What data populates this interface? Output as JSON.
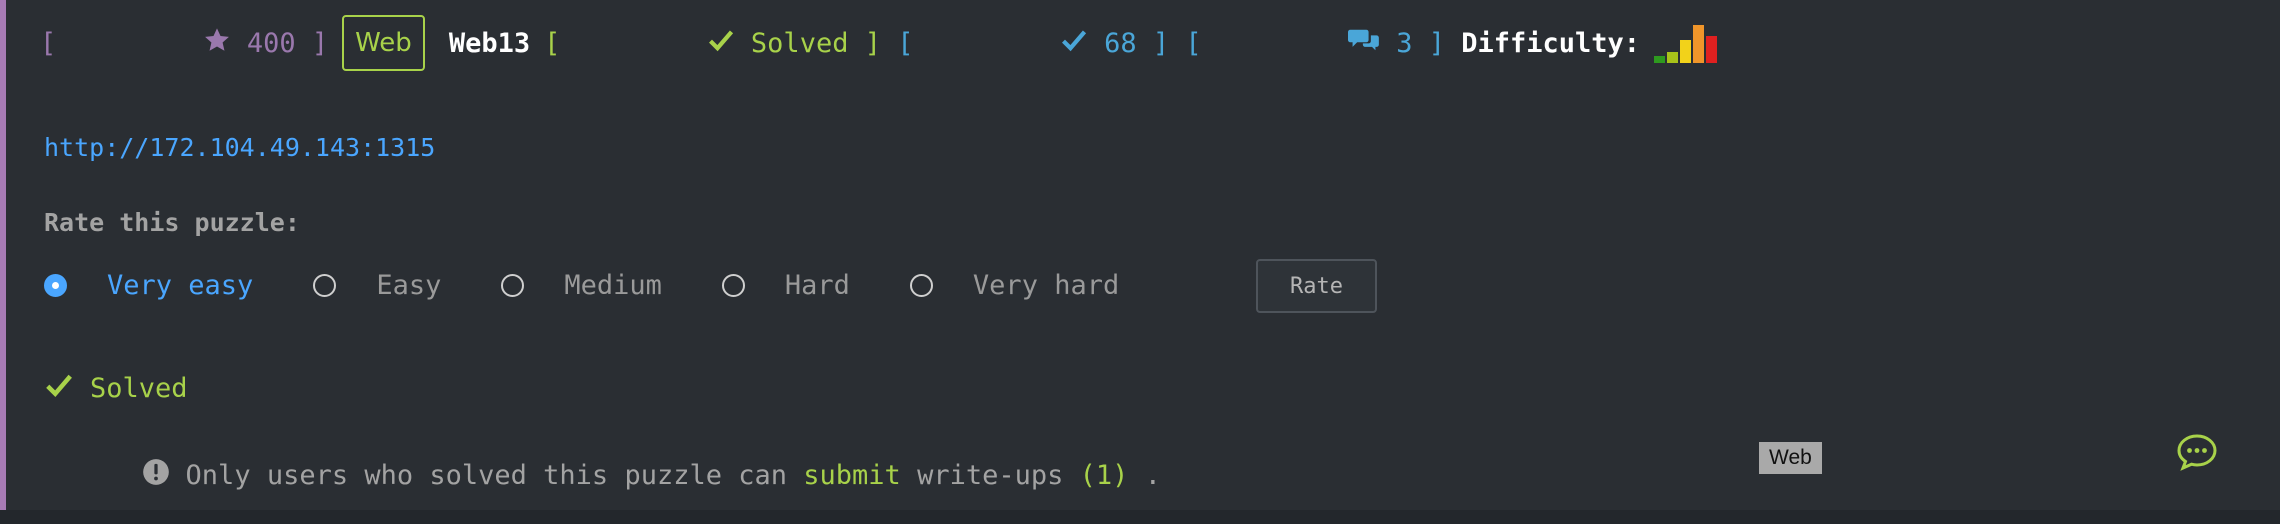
{
  "colors": {
    "accent_green": "#a8d24a",
    "accent_blue": "#4aa6ff",
    "points_purple": "#9a78ad",
    "solves_blue": "#4aa6d8",
    "background": "#2a2e33"
  },
  "header": {
    "points": "400",
    "points_icon": "star-icon",
    "category": "Web",
    "name": "Web13",
    "status": "Solved",
    "status_icon": "check-icon",
    "solves": "68",
    "solves_icon": "check-icon",
    "comments": "3",
    "comments_icon": "comments-icon",
    "difficulty_label": "Difficulty:",
    "difficulty_bars": [
      {
        "level": 0.18,
        "color": "#2e9a1f"
      },
      {
        "level": 0.3,
        "color": "#a8c21a"
      },
      {
        "level": 0.6,
        "color": "#f2d21a"
      },
      {
        "level": 1.0,
        "color": "#f0952a"
      },
      {
        "level": 0.72,
        "color": "#e02020"
      }
    ]
  },
  "url": "http://172.104.49.143:1315",
  "rating": {
    "title": "Rate this puzzle:",
    "options": [
      "Very easy",
      "Easy",
      "Medium",
      "Hard",
      "Very hard"
    ],
    "selected": "Very easy",
    "button_label": "Rate"
  },
  "status_line": {
    "icon": "check-icon",
    "text": "Solved"
  },
  "writeups": {
    "icon": "exclamation-circle-icon",
    "prefix": "Only users who solved this puzzle can",
    "link": "submit",
    "middle": "write-ups",
    "count": "(1)",
    "suffix": "."
  },
  "tooltip": "Web",
  "chat_icon": "chat-bubble-icon"
}
